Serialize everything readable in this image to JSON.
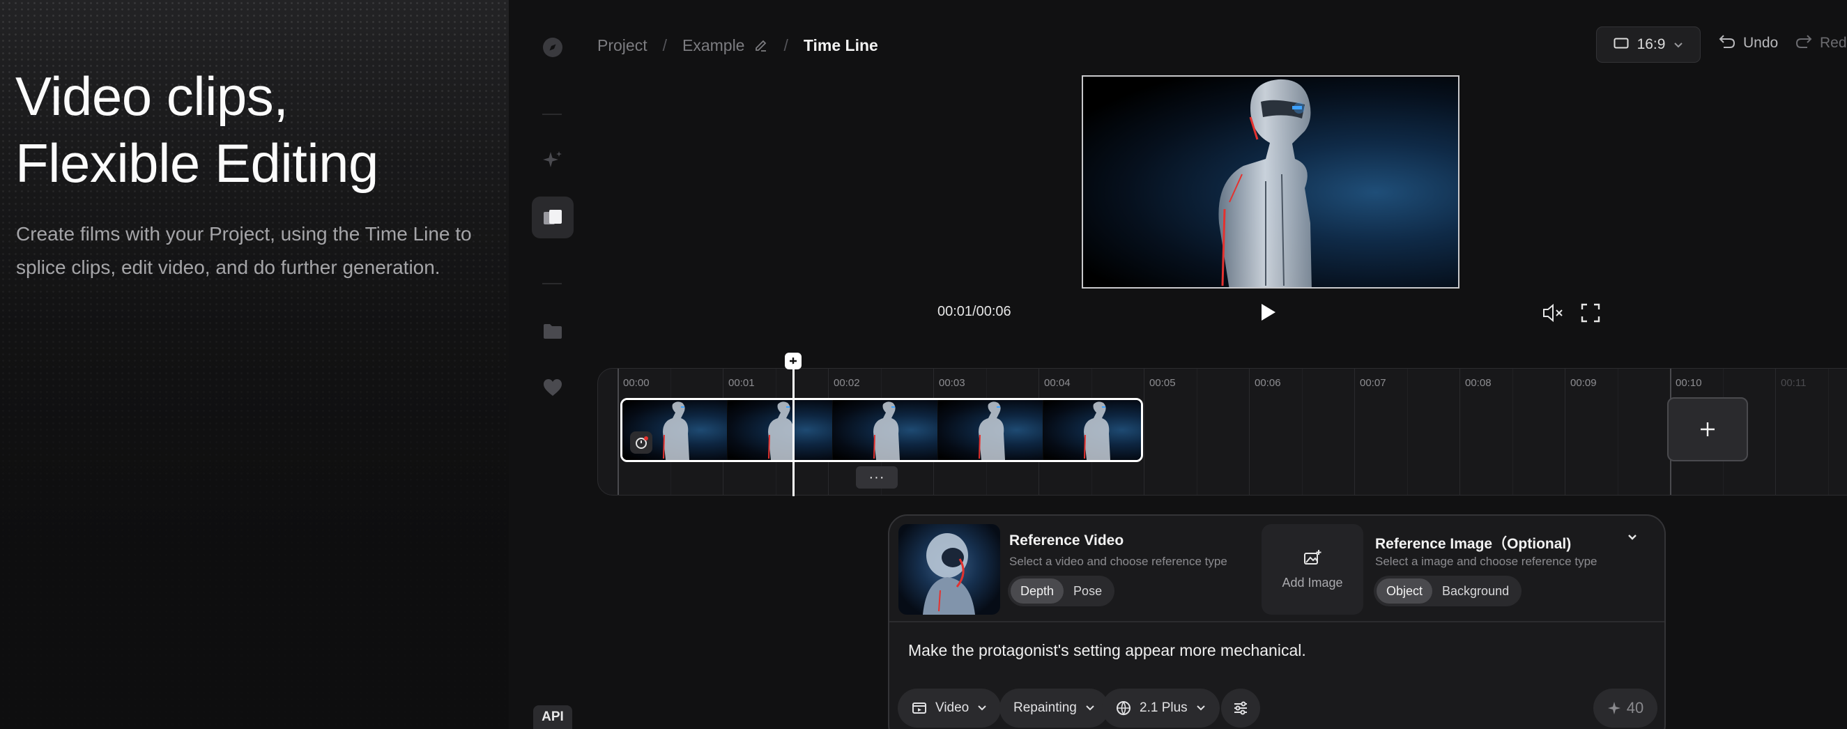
{
  "hero": {
    "title": "Video clips,\nFlexible Editing",
    "description": "Create films with your Project, using the Time Line to splice clips, edit video, and do  further generation."
  },
  "rail": {
    "api_label": "API",
    "icons": [
      "compass-icon",
      "sparkle-icon",
      "timeline-layers-icon",
      "folder-icon",
      "heart-icon"
    ]
  },
  "breadcrumb": {
    "project": "Project",
    "sep": "/",
    "example": "Example",
    "current": "Time Line"
  },
  "toolbar": {
    "aspect_ratio": "16:9",
    "undo_label": "Undo",
    "redo_label": "Red"
  },
  "player": {
    "time": "00:01/00:06"
  },
  "timeline": {
    "ticks": [
      "00:00",
      "00:01",
      "00:02",
      "00:03",
      "00:04",
      "00:05",
      "00:06",
      "00:07",
      "00:08",
      "00:09",
      "00:10",
      "00:11"
    ],
    "clip_menu": "···",
    "add_label": "+"
  },
  "panel": {
    "ref_video_title": "Reference Video",
    "ref_video_sub": "Select a video and choose reference type",
    "video_types": [
      "Depth",
      "Pose"
    ],
    "video_type_selected": "Depth",
    "add_image_label": "Add Image",
    "ref_image_title": "Reference Image（Optional)",
    "ref_image_sub": "Select a image and choose reference type",
    "image_types": [
      "Object",
      "Background"
    ],
    "image_type_selected": "Object",
    "prompt": "Make the protagonist's setting appear more mechanical.",
    "mode": "Video",
    "operation": "Repainting",
    "model": "2.1 Plus",
    "credits": "40"
  },
  "colors": {
    "accent_red": "#e4322f",
    "accent_blue": "#3ea2ff"
  }
}
